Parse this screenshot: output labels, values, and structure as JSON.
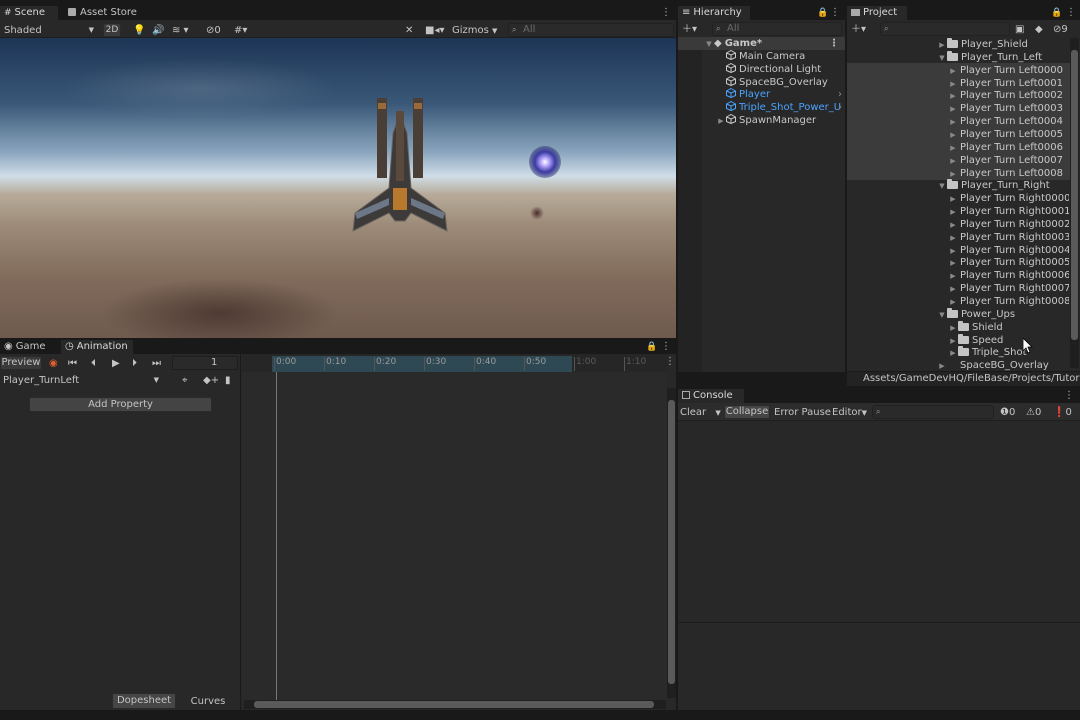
{
  "scene_tabs": {
    "scene": "Scene",
    "asset_store": "Asset Store"
  },
  "scene_toolbar": {
    "shading": "Shaded",
    "mode_2d": "2D",
    "hidden_count": "0",
    "gizmos": "Gizmos",
    "search_placeholder": "All"
  },
  "hierarchy": {
    "tab": "Hierarchy",
    "search_placeholder": "All",
    "root": "Game*",
    "items": [
      {
        "label": "Main Camera",
        "color": "#c8c8c8"
      },
      {
        "label": "Directional Light",
        "color": "#c8c8c8"
      },
      {
        "label": "SpaceBG_Overlay",
        "color": "#c8c8c8"
      },
      {
        "label": "Player",
        "color": "#4aa3ff"
      },
      {
        "label": "Triple_Shot_Power_U",
        "color": "#4aa3ff"
      },
      {
        "label": "SpawnManager",
        "color": "#c8c8c8"
      }
    ]
  },
  "project": {
    "tab": "Project",
    "hidden_count": "9",
    "items": [
      {
        "label": "Player_Shield",
        "kind": "folder",
        "indent": 0,
        "arrow": "▶"
      },
      {
        "label": "Player_Turn_Left",
        "kind": "folder-open",
        "indent": 0,
        "arrow": "▼"
      },
      {
        "label": "Player Turn Left0000",
        "kind": "sprite",
        "indent": 1,
        "arrow": "▶"
      },
      {
        "label": "Player Turn Left0001",
        "kind": "sprite",
        "indent": 1,
        "arrow": "▶"
      },
      {
        "label": "Player Turn Left0002",
        "kind": "sprite",
        "indent": 1,
        "arrow": "▶"
      },
      {
        "label": "Player Turn Left0003",
        "kind": "sprite",
        "indent": 1,
        "arrow": "▶"
      },
      {
        "label": "Player Turn Left0004",
        "kind": "sprite",
        "indent": 1,
        "arrow": "▶"
      },
      {
        "label": "Player Turn Left0005",
        "kind": "sprite",
        "indent": 1,
        "arrow": "▶"
      },
      {
        "label": "Player Turn Left0006",
        "kind": "sprite",
        "indent": 1,
        "arrow": "▶"
      },
      {
        "label": "Player Turn Left0007",
        "kind": "sprite",
        "indent": 1,
        "arrow": "▶"
      },
      {
        "label": "Player Turn Left0008",
        "kind": "sprite",
        "indent": 1,
        "arrow": "▶"
      },
      {
        "label": "Player_Turn_Right",
        "kind": "folder-open",
        "indent": 0,
        "arrow": "▼"
      },
      {
        "label": "Player Turn Right0000",
        "kind": "sprite",
        "indent": 1,
        "arrow": "▶"
      },
      {
        "label": "Player Turn Right0001",
        "kind": "sprite",
        "indent": 1,
        "arrow": "▶"
      },
      {
        "label": "Player Turn Right0002",
        "kind": "sprite",
        "indent": 1,
        "arrow": "▶"
      },
      {
        "label": "Player Turn Right0003",
        "kind": "sprite",
        "indent": 1,
        "arrow": "▶"
      },
      {
        "label": "Player Turn Right0004",
        "kind": "sprite",
        "indent": 1,
        "arrow": "▶"
      },
      {
        "label": "Player Turn Right0005",
        "kind": "sprite",
        "indent": 1,
        "arrow": "▶"
      },
      {
        "label": "Player Turn Right0006",
        "kind": "sprite",
        "indent": 1,
        "arrow": "▶"
      },
      {
        "label": "Player Turn Right0007",
        "kind": "sprite",
        "indent": 1,
        "arrow": "▶"
      },
      {
        "label": "Player Turn Right0008",
        "kind": "sprite",
        "indent": 1,
        "arrow": "▶"
      },
      {
        "label": "Power_Ups",
        "kind": "folder-open",
        "indent": 0,
        "arrow": "▼"
      },
      {
        "label": "Shield",
        "kind": "folder",
        "indent": 1,
        "arrow": "▶"
      },
      {
        "label": "Speed",
        "kind": "folder",
        "indent": 1,
        "arrow": "▶"
      },
      {
        "label": "Triple_Shot",
        "kind": "folder",
        "indent": 1,
        "arrow": "▶"
      },
      {
        "label": "SpaceBG_Overlay",
        "kind": "asset",
        "indent": 0,
        "arrow": "▶"
      }
    ],
    "path": "Assets/GameDevHQ/FileBase/Projects/Tutorials"
  },
  "bottom_tabs": {
    "game": "Game",
    "animation": "Animation"
  },
  "animation": {
    "preview": "Preview",
    "frame": "1",
    "clip": "Player_TurnLeft",
    "add_property": "Add Property",
    "ticks": [
      "0:00",
      "0:10",
      "0:20",
      "0:30",
      "0:40",
      "0:50",
      "1:00",
      "1:10"
    ],
    "dopesheet": "Dopesheet",
    "curves": "Curves"
  },
  "console": {
    "tab": "Console",
    "clear": "Clear",
    "collapse": "Collapse",
    "error_pause": "Error Pause",
    "editor": "Editor",
    "log_count": "0",
    "warn_count": "0",
    "error_count": "0"
  }
}
